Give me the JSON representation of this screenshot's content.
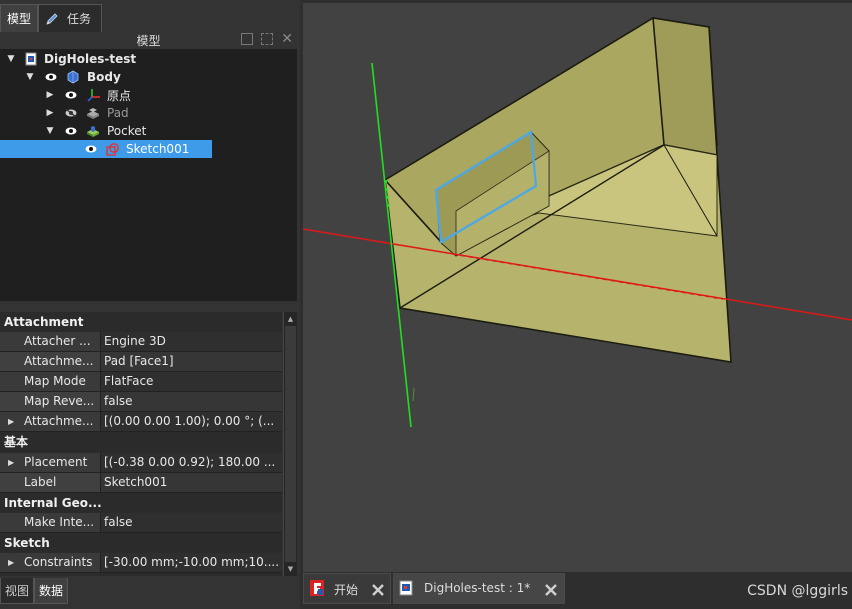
{
  "top_tabs": [
    {
      "label": "模型",
      "active": true
    },
    {
      "label": "任务",
      "active": false
    }
  ],
  "model_panel": {
    "title": "模型"
  },
  "tree": [
    {
      "label": "DigHoles-test",
      "icon": "document-icon",
      "bold": true
    },
    {
      "label": "Body",
      "icon": "body-icon",
      "bold": true
    },
    {
      "label": "原点",
      "icon": "origin-axes-icon"
    },
    {
      "label": "Pad",
      "icon": "pad-icon",
      "dimmed": true
    },
    {
      "label": "Pocket",
      "icon": "pocket-icon"
    },
    {
      "label": "Sketch001",
      "icon": "sketch-icon",
      "selected": true
    }
  ],
  "properties": [
    {
      "type": "group",
      "label": "Attachment"
    },
    {
      "type": "item",
      "name": "Attacher ...",
      "value": "Engine 3D"
    },
    {
      "type": "item",
      "name": "Attachme...",
      "value": "Pad [Face1]"
    },
    {
      "type": "item",
      "name": "Map Mode",
      "value": "FlatFace"
    },
    {
      "type": "item",
      "name": "Map Reve...",
      "value": "false"
    },
    {
      "type": "item",
      "name": "Attachme...",
      "value": "[(0.00 0.00 1.00); 0.00 °; (...",
      "expandable": true
    },
    {
      "type": "group",
      "label": "基本"
    },
    {
      "type": "item",
      "name": "Placement",
      "value": "[(-0.38 0.00 0.92); 180.00 ...",
      "expandable": true
    },
    {
      "type": "item",
      "name": "Label",
      "value": "Sketch001"
    },
    {
      "type": "group",
      "label": "Internal Geo..."
    },
    {
      "type": "item",
      "name": "Make Inte...",
      "value": "false"
    },
    {
      "type": "group",
      "label": "Sketch"
    },
    {
      "type": "item",
      "name": "Constraints",
      "value": "[-30.00 mm;-10.00 mm;10....",
      "expandable": true
    }
  ],
  "bottom_tabs": [
    {
      "label": "视图",
      "active": false
    },
    {
      "label": "数据",
      "active": true
    }
  ],
  "doc_tabs": [
    {
      "label": "开始",
      "icon": "freecad-start-icon",
      "active": false
    },
    {
      "label": "DigHoles-test : 1*",
      "icon": "freecad-document-icon",
      "active": true
    }
  ],
  "watermark": "CSDN @lggirls",
  "colors": {
    "selection": "#3d9be9",
    "solid_face": "#b5b36a",
    "x_axis": "#e01818",
    "y_axis": "#22dd22",
    "sketch_outline": "#4aa8e8"
  }
}
